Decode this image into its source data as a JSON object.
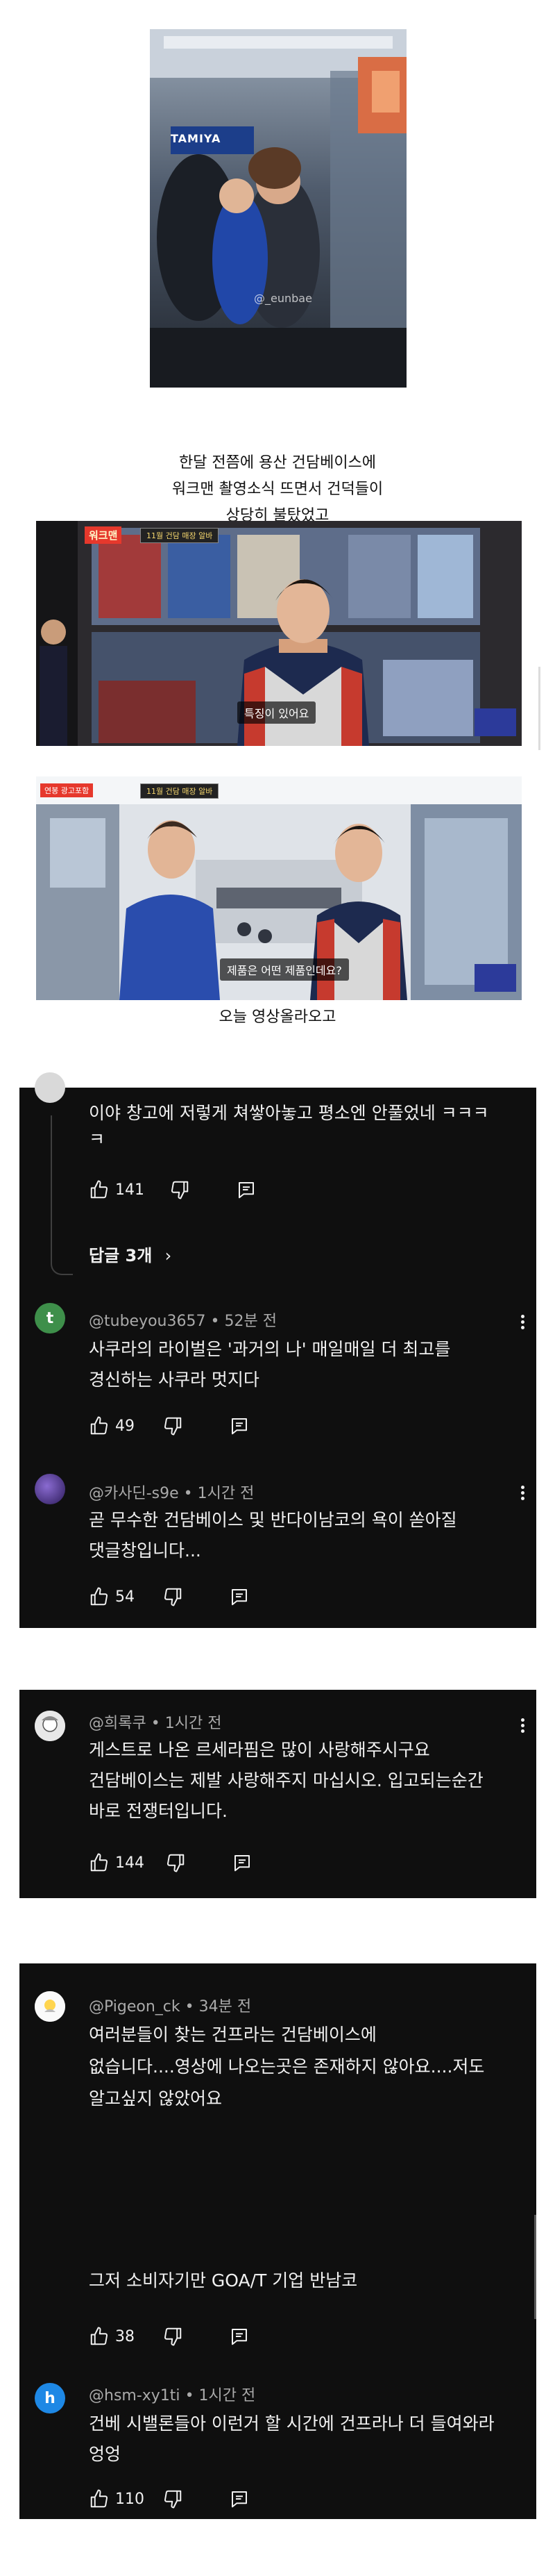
{
  "post": {
    "photo1": {
      "watermark": "@_eunbae",
      "shop_sign": "TAMIYA"
    },
    "caption1": [
      "한달 전쯤에 용산 건담베이스에",
      "워크맨 촬영소식 뜨면서 건덕들이",
      "상당히 불탔었고"
    ],
    "video1": {
      "logo": "워크맨",
      "banner": "11월 건담 매장 알바",
      "subtitle": "특징이 있어요"
    },
    "video2": {
      "logo": "연봉 광고포함",
      "banner": "11월 건담 매장 알바",
      "subtitle": "제품은 어떤 제품인데요?"
    },
    "caption2": "오늘 영상올라오고"
  },
  "comments": {
    "block1": {
      "top_comment": {
        "text": [
          "이야 창고에 저렇게 쳐쌓아놓고 평소엔 안풀었네 ㅋㅋㅋ",
          "ㅋ"
        ],
        "likes": "141"
      },
      "replies_label": "답글 3개",
      "items": [
        {
          "avatar_letter": "t",
          "avatar_color": "#3e8f4a",
          "author": "@tubeyou3657",
          "time": "52분 전",
          "text": [
            "사쿠라의 라이벌은 '과거의 나' 매일매일 더 최고를",
            "경신하는 사쿠라 멋지다"
          ],
          "likes": "49"
        },
        {
          "avatar_letter": "",
          "avatar_color": "#5b3b8c",
          "author": "@카사딘-s9e",
          "time": "1시간 전",
          "text": [
            "곧 무수한 건담베이스 및 반다이남코의 욕이 쏟아질",
            "댓글창입니다..."
          ],
          "likes": "54"
        }
      ]
    },
    "block2": {
      "items": [
        {
          "avatar_color": "#d9d9d9",
          "author": "@희록쿠",
          "time": "1시간 전",
          "text": [
            "게스트로 나온 르세라핌은 많이 사랑해주시구요",
            "건담베이스는 제발 사랑해주지 마십시오. 입고되는순간",
            "바로 전쟁터입니다."
          ],
          "likes": "144"
        }
      ]
    },
    "block3": {
      "items": [
        {
          "avatar_color": "#f5f5f5",
          "author": "@Pigeon_ck",
          "time": "34분 전",
          "text": [
            "여러분들이 찾는 건프라는 건담베이스에",
            "없습니다....영상에 나오는곳은 존재하지 않아요....저도",
            "알고싶지 않았어요"
          ],
          "text2": "그저 소비자기만 GOA/T 기업 반남코",
          "likes": "38"
        },
        {
          "avatar_letter": "h",
          "avatar_color": "#1e88e5",
          "author": "@hsm-xy1ti",
          "time": "1시간 전",
          "text": [
            "건베 시밸론들아 이런거 할 시간에 건프라나 더 들여와라",
            "엉엉"
          ],
          "likes": "110"
        }
      ]
    }
  }
}
